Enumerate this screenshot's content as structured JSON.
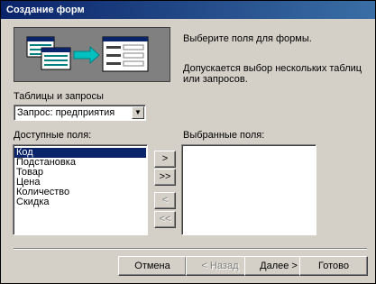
{
  "window": {
    "title": "Создание форм"
  },
  "description": {
    "line1": "Выберите поля для формы.",
    "line2": "Допускается выбор нескольких таблиц или запросов."
  },
  "tables": {
    "label": "Таблицы и запросы",
    "selected": "Запрос: предприятия"
  },
  "available": {
    "label": "Доступные поля:",
    "items": [
      "Код",
      "Подстановка",
      "Товар",
      "Цена",
      "Количество",
      "Скидка"
    ],
    "selected_index": 0
  },
  "chosen": {
    "label": "Выбранные поля:",
    "items": []
  },
  "move_buttons": {
    "add_one": ">",
    "add_all": ">>",
    "remove_one": "<",
    "remove_all": "<<"
  },
  "footer": {
    "cancel": "Отмена",
    "back": "< Назад",
    "next": "Далее >",
    "finish": "Готово"
  },
  "colors": {
    "selection": "#0a246a",
    "illustration_bg": "#808080"
  }
}
